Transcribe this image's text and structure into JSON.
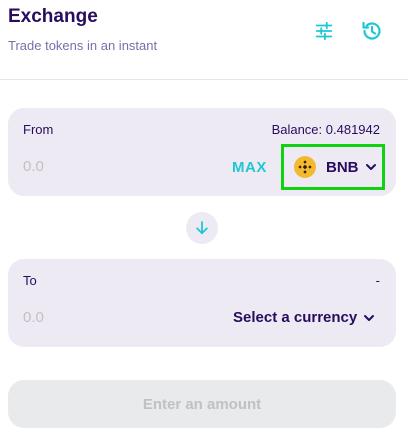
{
  "header": {
    "title": "Exchange",
    "subtitle": "Trade tokens in an instant",
    "settings_icon": "sliders-icon",
    "history_icon": "history-icon"
  },
  "from": {
    "label": "From",
    "balance": "Balance: 0.481942",
    "amount_placeholder": "0.0",
    "max_label": "MAX",
    "currency": "BNB",
    "currency_icon": "bnb-icon",
    "highlight_color": "#12d012"
  },
  "swap": {
    "icon": "arrow-down-icon"
  },
  "to": {
    "label": "To",
    "balance": "-",
    "amount_placeholder": "0.0",
    "select_label": "Select a currency"
  },
  "submit": {
    "label": "Enter an amount"
  },
  "colors": {
    "primary_text": "#280d5f",
    "secondary_text": "#7a6eaa",
    "accent": "#1fc7d4",
    "panel_bg": "#eeeaf4",
    "disabled_bg": "#e9eaeb",
    "disabled_text": "#bdc2c4"
  }
}
